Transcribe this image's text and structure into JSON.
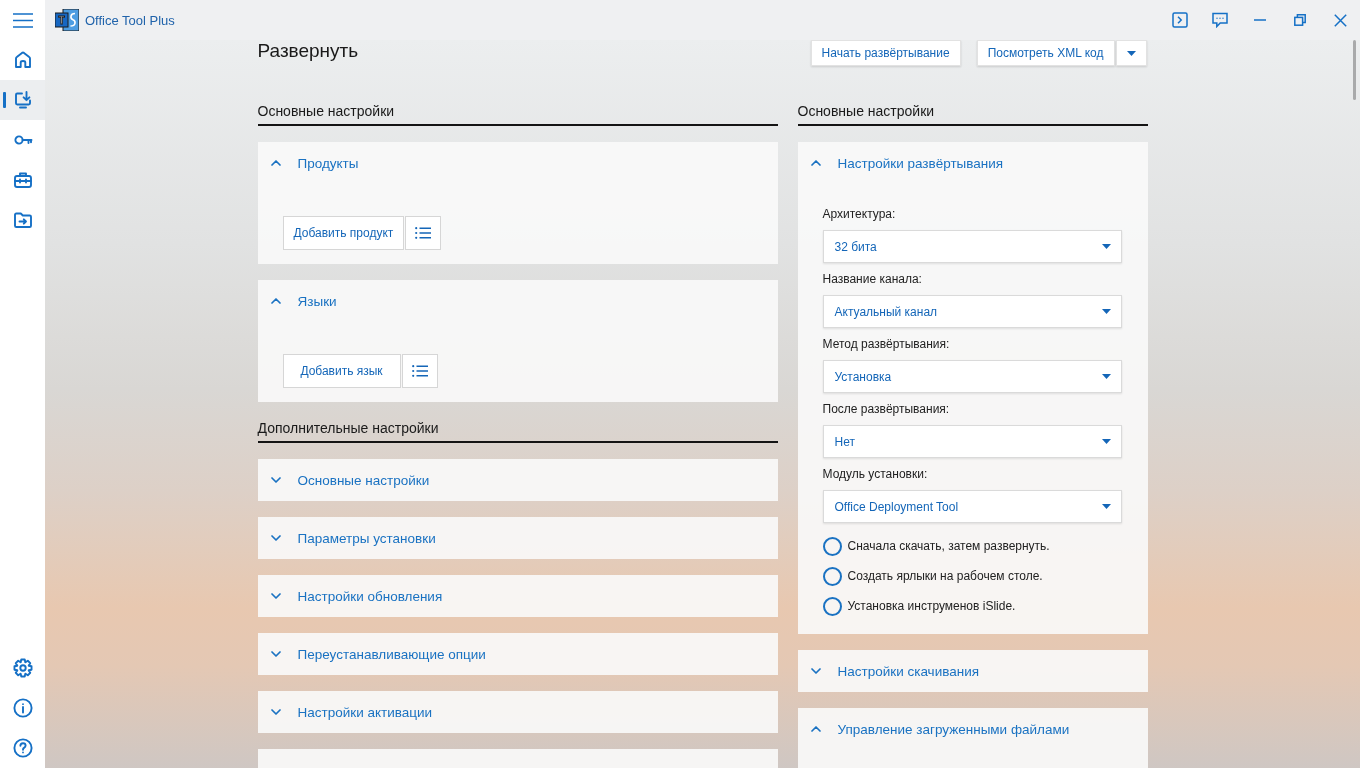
{
  "window": {
    "title": "Office Tool Plus",
    "logo_text": "T"
  },
  "sidebar": {
    "items": [
      {
        "kind": "home",
        "selected": false
      },
      {
        "kind": "deploy",
        "selected": true
      },
      {
        "kind": "key",
        "selected": false
      },
      {
        "kind": "toolbox",
        "selected": false
      },
      {
        "kind": "folder",
        "selected": false
      }
    ],
    "bottom_items": [
      {
        "kind": "settings",
        "selected": false
      },
      {
        "kind": "info",
        "selected": false
      },
      {
        "kind": "help",
        "selected": false
      }
    ]
  },
  "page": {
    "title": "Развернуть",
    "start_button": "Начать развёртывание",
    "xml_button": "Посмотреть XML код"
  },
  "left_column": {
    "sections": [
      {
        "heading": "Основные настройки",
        "cards": [
          {
            "title": "Продукты",
            "expanded": true,
            "button": "Добавить продукт"
          },
          {
            "title": "Языки",
            "expanded": true,
            "button": "Добавить язык"
          }
        ]
      },
      {
        "heading": "Дополнительные настройки",
        "cards": [
          {
            "title": "Основные настройки",
            "expanded": false
          },
          {
            "title": "Параметры установки",
            "expanded": false
          },
          {
            "title": "Настройки обновления",
            "expanded": false
          },
          {
            "title": "Переустанавливающие опции",
            "expanded": false
          },
          {
            "title": "Настройки активации",
            "expanded": false
          }
        ]
      }
    ],
    "cut_off_card": true
  },
  "right_column": {
    "heading": "Основные настройки",
    "cards": [
      {
        "title": "Настройки развёртывания",
        "expanded": true,
        "fields": [
          {
            "label": "Архитектура:",
            "value": "32 бита"
          },
          {
            "label": "Название канала:",
            "value": "Актуальный канал"
          },
          {
            "label": "Метод развёртывания:",
            "value": "Установка"
          },
          {
            "label": "После развёртывания:",
            "value": "Нет"
          },
          {
            "label": "Модуль установки:",
            "value": "Office Deployment Tool"
          }
        ],
        "options": [
          {
            "label": "Сначала скачать, затем развернуть.",
            "checked": false
          },
          {
            "label": "Создать ярлыки на рабочем столе.",
            "checked": false
          },
          {
            "label": "Установка инструменов iSlide.",
            "checked": false
          }
        ]
      },
      {
        "title": "Настройки скачивания",
        "expanded": false
      },
      {
        "title": "Управление загруженными файлами",
        "expanded": true
      }
    ]
  }
}
